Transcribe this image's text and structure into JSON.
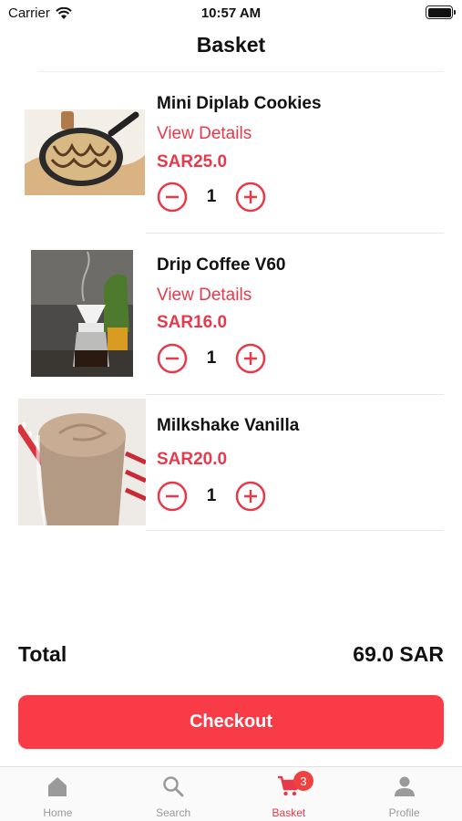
{
  "status_bar": {
    "carrier": "Carrier",
    "time": "10:57 AM"
  },
  "header": {
    "title": "Basket"
  },
  "items": [
    {
      "name": "Mini Diplab Cookies",
      "details_label": "View Details",
      "price": "SAR25.0",
      "quantity": "1"
    },
    {
      "name": "Drip Coffee V60",
      "details_label": "View Details",
      "price": "SAR16.0",
      "quantity": "1"
    },
    {
      "name": "Milkshake Vanilla",
      "price": "SAR20.0",
      "quantity": "1"
    }
  ],
  "summary": {
    "total_label": "Total",
    "total_value": "69.0 SAR"
  },
  "checkout_label": "Checkout",
  "tabbar": {
    "tabs": [
      {
        "label": "Home",
        "icon": "home-icon"
      },
      {
        "label": "Search",
        "icon": "search-icon"
      },
      {
        "label": "Basket",
        "icon": "cart-icon",
        "badge": "3",
        "active": true
      },
      {
        "label": "Profile",
        "icon": "profile-icon"
      }
    ]
  },
  "colors": {
    "accent": "#e8394a",
    "checkout": "#f93a47",
    "badge": "#f04040"
  }
}
